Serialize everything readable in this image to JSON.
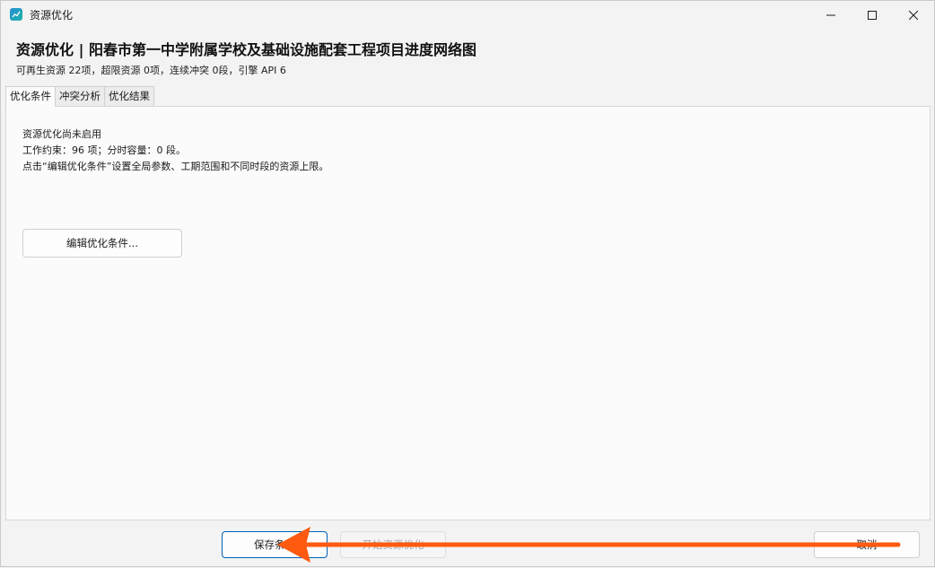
{
  "window": {
    "title": "资源优化"
  },
  "header": {
    "title": "资源优化 | 阳春市第一中学附属学校及基础设施配套工程项目进度网络图",
    "subtitle": "可再生资源 22项，超限资源 0项，连续冲突 0段，引擎 API 6"
  },
  "tabs": [
    {
      "label": "优化条件",
      "active": true
    },
    {
      "label": "冲突分析",
      "active": false
    },
    {
      "label": "优化结果",
      "active": false
    }
  ],
  "panel": {
    "status": "资源优化尚未启用",
    "constraints": "工作约束：96 项；分时容量：0 段。",
    "hint": "点击“编辑优化条件”设置全局参数、工期范围和不同时段的资源上限。",
    "edit_button": "编辑优化条件..."
  },
  "footer": {
    "save_button": "保存条件",
    "start_button": "开始资源优化",
    "cancel_button": "取消"
  },
  "colors": {
    "accent": "#005fb8",
    "annotation_arrow": "#ff5a10"
  },
  "icons": {
    "app": "chart-icon",
    "minimize": "minimize-icon",
    "maximize": "maximize-icon",
    "close": "close-icon",
    "annotation": "arrow-left-annotation"
  }
}
